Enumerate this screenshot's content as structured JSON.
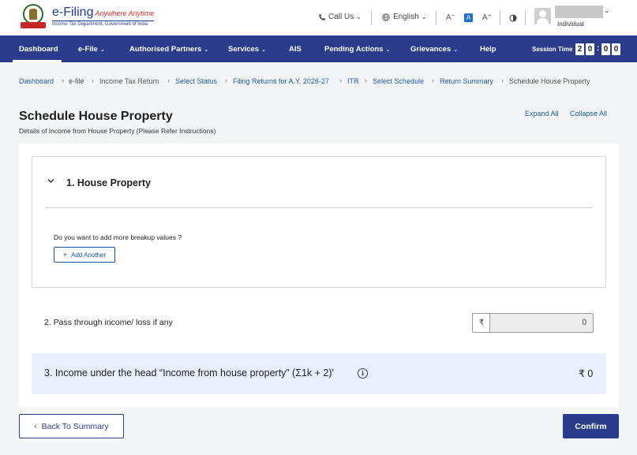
{
  "header": {
    "logo_title": "e-Filing",
    "logo_tagline": "Anywhere Anytime",
    "logo_sub": "Income Tax Department, Government of India",
    "call_us": "Call Us",
    "language": "English",
    "font_decrease": "A⁻",
    "font_default": "A",
    "font_increase": "A⁺",
    "user_role": "Individual"
  },
  "nav": {
    "items": [
      "Dashboard",
      "e-File",
      "Authorised Partners",
      "Services",
      "AIS",
      "Pending Actions",
      "Grievances",
      "Help"
    ],
    "session_label": "Session Time",
    "session_digits": [
      "2",
      "0",
      "0",
      "0"
    ]
  },
  "breadcrumb": {
    "items": [
      "Dashboard",
      "e-file",
      "Income Tax Return",
      "Select Status",
      "Filing Returns for A.Y. 2026-27",
      "ITR",
      "Select Schedule",
      "Return Summary",
      "Schedule House Property"
    ]
  },
  "page": {
    "title": "Schedule House Property",
    "subtitle": "Details of Income from House Property (Please Refer Instructions)",
    "expand_all": "Expand All",
    "collapse_all": "Collapse All"
  },
  "section1": {
    "title": "1. House Property",
    "question": "Do you want to add more breakup values ?",
    "add_button": "Add Another"
  },
  "row2": {
    "label": "2. Pass through income/ loss if any",
    "currency": "₹",
    "value": "0"
  },
  "row3": {
    "label": "3. Income under the head “Income from house property” (Σ1k + 2)'",
    "value": "₹ 0"
  },
  "footer": {
    "back_button": "Back To Summary",
    "confirm_button": "Confirm"
  },
  "colors": {
    "nav_bg": "#2c3c8c",
    "link": "#1f5fae",
    "highlight_row": "#e8f0fb"
  }
}
